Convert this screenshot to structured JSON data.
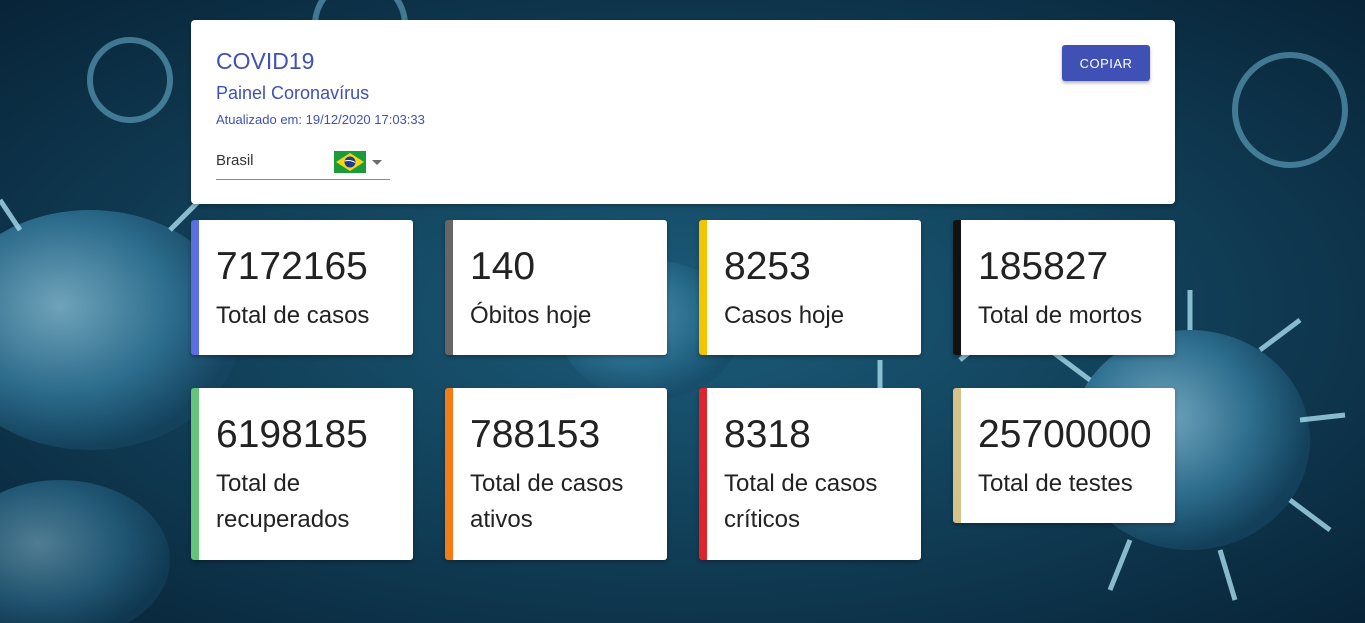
{
  "header": {
    "title": "COVID19",
    "subtitle": "Painel Coronavírus",
    "updated_label": "Atualizado em: 19/12/2020 17:03:33",
    "copy_button": "COPIAR"
  },
  "country_select": {
    "selected": "Brasil",
    "flag_icon": "brazil-flag-icon"
  },
  "stats": [
    {
      "value": "7172165",
      "label": "Total de casos",
      "color": "#5b6ee1"
    },
    {
      "value": "140",
      "label": "Óbitos hoje",
      "color": "#666666"
    },
    {
      "value": "8253",
      "label": "Casos hoje",
      "color": "#f5c400"
    },
    {
      "value": "185827",
      "label": "Total de mortos",
      "color": "#111111"
    },
    {
      "value": "6198185",
      "label": "Total de recuperados",
      "color": "#66c47a"
    },
    {
      "value": "788153",
      "label": "Total de casos ativos",
      "color": "#f57c14"
    },
    {
      "value": "8318",
      "label": "Total de casos críticos",
      "color": "#e0242e"
    },
    {
      "value": "25700000",
      "label": "Total de testes",
      "color": "#d4c28a"
    }
  ],
  "colors": {
    "accent": "#3f51b5",
    "background": "#0d3550"
  }
}
